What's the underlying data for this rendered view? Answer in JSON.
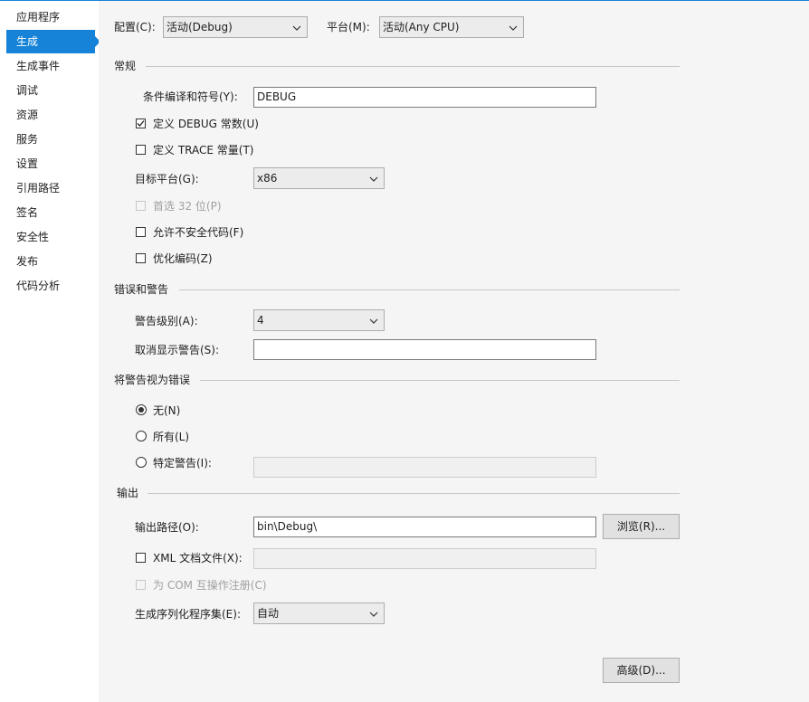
{
  "sidebar": {
    "items": [
      {
        "label": "应用程序"
      },
      {
        "label": "生成"
      },
      {
        "label": "生成事件"
      },
      {
        "label": "调试"
      },
      {
        "label": "资源"
      },
      {
        "label": "服务"
      },
      {
        "label": "设置"
      },
      {
        "label": "引用路径"
      },
      {
        "label": "签名"
      },
      {
        "label": "安全性"
      },
      {
        "label": "发布"
      },
      {
        "label": "代码分析"
      }
    ]
  },
  "toolbar": {
    "config_label": "配置(C):",
    "config_value": "活动(Debug)",
    "platform_label": "平台(M):",
    "platform_value": "活动(Any CPU)"
  },
  "general": {
    "title": "常规",
    "conditional_label": "条件编译和符号(Y):",
    "conditional_value": "DEBUG",
    "define_debug_label": "定义 DEBUG 常数(U)",
    "define_debug_checked": true,
    "define_trace_label": "定义 TRACE 常量(T)",
    "define_trace_checked": false,
    "target_label": "目标平台(G):",
    "target_value": "x86",
    "prefer32_label": "首选 32 位(P)",
    "prefer32_checked": false,
    "unsafe_label": "允许不安全代码(F)",
    "unsafe_checked": false,
    "optimize_label": "优化编码(Z)",
    "optimize_checked": false
  },
  "errors": {
    "title": "错误和警告",
    "warning_level_label": "警告级别(A):",
    "warning_level_value": "4",
    "suppress_label": "取消显示警告(S):",
    "suppress_value": ""
  },
  "treat_warnings": {
    "title": "将警告视为错误",
    "none_label": "无(N)",
    "all_label": "所有(L)",
    "specific_label": "特定警告(I):",
    "selected": "none",
    "specific_value": ""
  },
  "output": {
    "title": "输出",
    "path_label": "输出路径(O):",
    "path_value": "bin\\Debug\\",
    "browse_label": "浏览(R)...",
    "xml_label": "XML 文档文件(X):",
    "xml_checked": false,
    "xml_value": "",
    "com_label": "为 COM 互操作注册(C)",
    "com_checked": false,
    "serialization_label": "生成序列化程序集(E):",
    "serialization_value": "自动"
  },
  "advanced_label": "高级(D)...",
  "colors": {
    "accent": "#1683d8",
    "panel_bg": "#f5f5f5",
    "sidebar_bg": "#ffffff"
  }
}
